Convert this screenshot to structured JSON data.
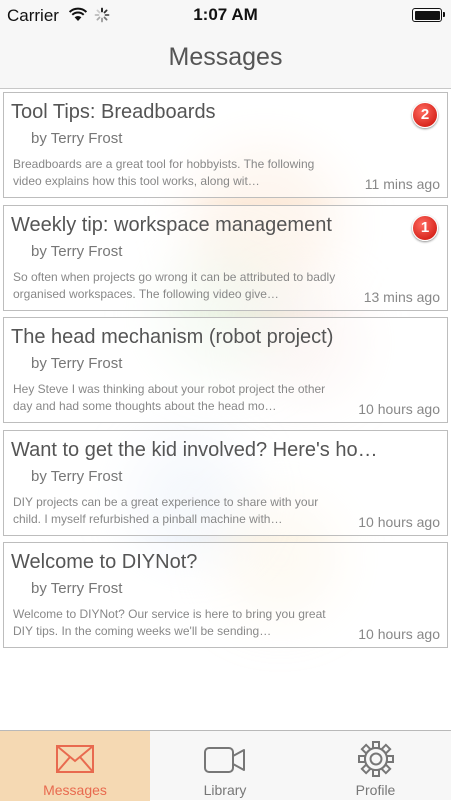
{
  "status_bar": {
    "carrier": "Carrier",
    "time": "1:07 AM"
  },
  "nav": {
    "title": "Messages"
  },
  "messages": [
    {
      "title": "Tool Tips: Breadboards",
      "author": "by Terry Frost",
      "preview": "Breadboards are a great tool for hobbyists. The following video explains how this tool works, along wit…",
      "time": "11 mins ago",
      "badge": "2"
    },
    {
      "title": "Weekly tip: workspace management",
      "author": "by Terry Frost",
      "preview": "So often when projects go wrong it can be attributed to badly organised workspaces. The following video give…",
      "time": "13 mins ago",
      "badge": "1"
    },
    {
      "title": "The head mechanism (robot project)",
      "author": "by Terry Frost",
      "preview": "Hey Steve I was thinking about your robot project the other day and had some thoughts about the head mo…",
      "time": "10 hours ago"
    },
    {
      "title": "Want to get the kid involved? Here's ho…",
      "author": "by Terry Frost",
      "preview": "DIY projects can be a great experience to share with your child. I myself refurbished a pinball machine with…",
      "time": "10 hours ago"
    },
    {
      "title": "Welcome to DIYNot?",
      "author": "by Terry Frost",
      "preview": "Welcome to DIYNot? Our service is here to bring you great DIY tips. In the coming weeks we'll be sending…",
      "time": "10 hours ago"
    }
  ],
  "tabs": [
    {
      "label": "Messages",
      "icon": "envelope-icon",
      "selected": true
    },
    {
      "label": "Library",
      "icon": "video-camera-icon",
      "selected": false
    },
    {
      "label": "Profile",
      "icon": "gear-icon",
      "selected": false
    }
  ],
  "colors": {
    "accent": "#e86a4f",
    "selected_tab_bg": "#f5d9b3",
    "badge": "#e0332a",
    "bars": "#f7f7f7"
  }
}
